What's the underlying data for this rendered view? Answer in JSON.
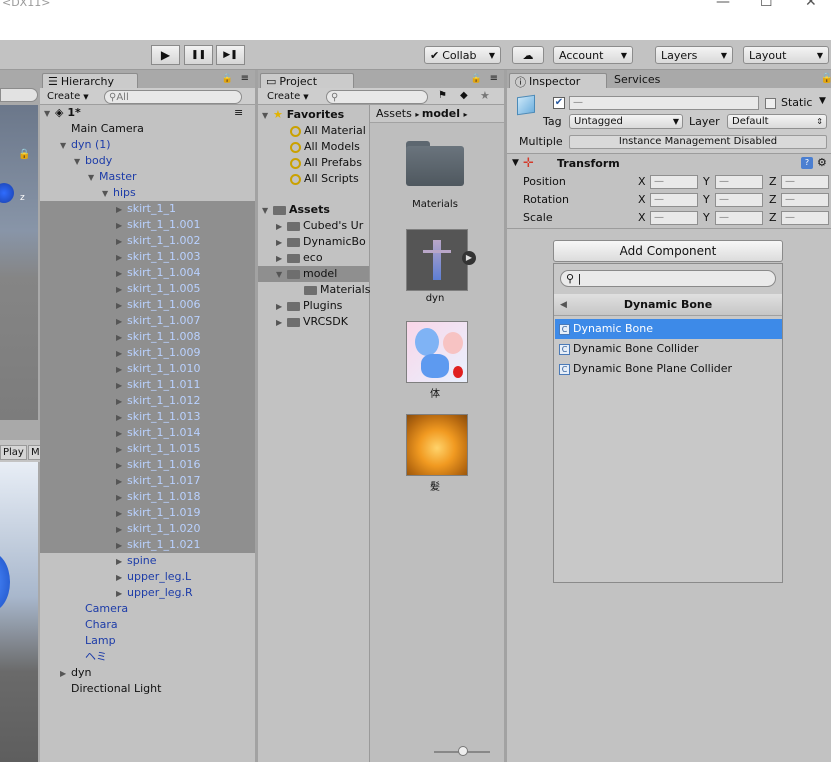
{
  "window": {
    "title": "<DX11>"
  },
  "toolbar": {
    "play": "▶",
    "pause": "❚❚",
    "step": "▶❚",
    "collab": "Collab",
    "cloud": "☁",
    "account": "Account",
    "layers": "Layers",
    "layout": "Layout"
  },
  "scene_left": {
    "play_tab": "Play",
    "m_tab": "M",
    "axis_z": "z"
  },
  "hierarchy": {
    "tab": "Hierarchy",
    "create": "Create",
    "search_placeholder": "All",
    "scene_name": "1*",
    "rows": [
      "Main Camera",
      "dyn (1)",
      "body",
      "Master",
      "hips",
      "skirt_1_1",
      "skirt_1_1.001",
      "skirt_1_1.002",
      "skirt_1_1.003",
      "skirt_1_1.004",
      "skirt_1_1.005",
      "skirt_1_1.006",
      "skirt_1_1.007",
      "skirt_1_1.008",
      "skirt_1_1.009",
      "skirt_1_1.010",
      "skirt_1_1.011",
      "skirt_1_1.012",
      "skirt_1_1.013",
      "skirt_1_1.014",
      "skirt_1_1.015",
      "skirt_1_1.016",
      "skirt_1_1.017",
      "skirt_1_1.018",
      "skirt_1_1.019",
      "skirt_1_1.020",
      "skirt_1_1.021",
      "spine",
      "upper_leg.L",
      "upper_leg.R",
      "Camera",
      "Chara",
      "Lamp",
      "ヘミ",
      "dyn",
      "Directional Light"
    ]
  },
  "project": {
    "tab": "Project",
    "create": "Create",
    "favorites_label": "Favorites",
    "favorites": [
      "All Material",
      "All Models",
      "All Prefabs",
      "All Scripts"
    ],
    "assets_label": "Assets",
    "folders": [
      "Cubed's Ur",
      "DynamicBo",
      "eco",
      "model",
      "Materials",
      "Plugins",
      "VRCSDK"
    ],
    "breadcrumb": [
      "Assets",
      "model"
    ],
    "thumbs": [
      "Materials",
      "dyn",
      "体",
      "髪"
    ]
  },
  "inspector": {
    "tab": "Inspector",
    "tab2": "Services",
    "name_value": "—",
    "static_label": "Static",
    "tag_label": "Tag",
    "tag_value": "Untagged",
    "layer_label": "Layer",
    "layer_value": "Default",
    "multiple_label": "Multiple",
    "multiple_value": "Instance Management Disabled",
    "transform": {
      "title": "Transform",
      "rows": [
        {
          "label": "Position",
          "x": "—",
          "y": "—",
          "z": "—"
        },
        {
          "label": "Rotation",
          "x": "—",
          "y": "—",
          "z": "—"
        },
        {
          "label": "Scale",
          "x": "—",
          "y": "—",
          "z": "—"
        }
      ],
      "axes": [
        "X",
        "Y",
        "Z"
      ]
    },
    "add_component": "Add Component",
    "component_popup": {
      "search_value": "|",
      "header": "Dynamic Bone",
      "items": [
        "Dynamic Bone",
        "Dynamic Bone Collider",
        "Dynamic Bone Plane Collider"
      ]
    }
  },
  "colors": {
    "selection": "#3d8ae8",
    "hier_selected_bg": "#8f8f8f",
    "blue_text": "#1d3ca8"
  }
}
